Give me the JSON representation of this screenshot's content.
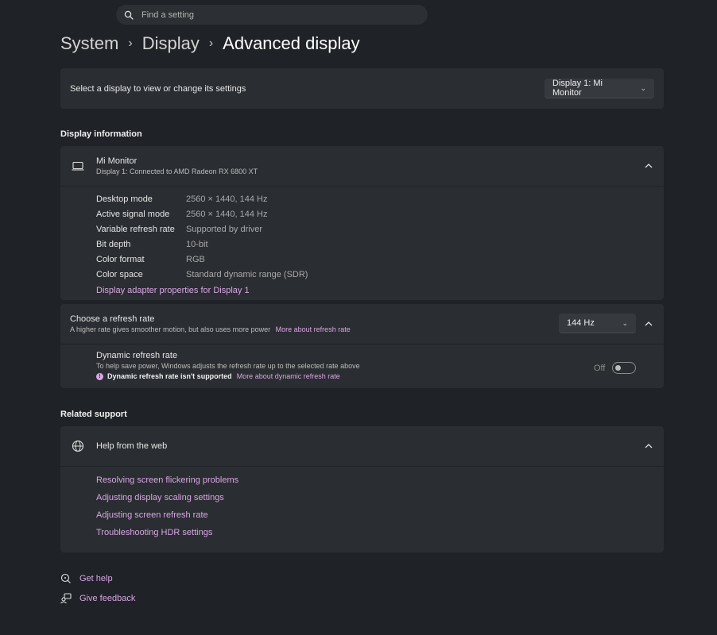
{
  "search": {
    "placeholder": "Find a setting"
  },
  "breadcrumb": {
    "level1": "System",
    "level2": "Display",
    "current": "Advanced display"
  },
  "select_display": {
    "label": "Select a display to view or change its settings",
    "value": "Display 1: Mi Monitor"
  },
  "display_info": {
    "section_title": "Display information",
    "monitor_name": "Mi Monitor",
    "monitor_sub": "Display 1: Connected to AMD Radeon RX 6800 XT",
    "rows": [
      {
        "label": "Desktop mode",
        "value": "2560 × 1440, 144 Hz"
      },
      {
        "label": "Active signal mode",
        "value": "2560 × 1440, 144 Hz"
      },
      {
        "label": "Variable refresh rate",
        "value": "Supported by driver"
      },
      {
        "label": "Bit depth",
        "value": "10-bit"
      },
      {
        "label": "Color format",
        "value": "RGB"
      },
      {
        "label": "Color space",
        "value": "Standard dynamic range (SDR)"
      }
    ],
    "adapter_link": "Display adapter properties for Display 1"
  },
  "refresh": {
    "title": "Choose a refresh rate",
    "subtitle": "A higher rate gives smoother motion, but also uses more power",
    "more_link": "More about refresh rate",
    "value": "144 Hz",
    "dynamic_title": "Dynamic refresh rate",
    "dynamic_sub": "To help save power, Windows adjusts the refresh rate up to the selected rate above",
    "not_supported": "Dynamic refresh rate isn't supported",
    "dynamic_link": "More about dynamic refresh rate",
    "toggle_state": "Off"
  },
  "related": {
    "section_title": "Related support",
    "help_title": "Help from the web",
    "links": [
      "Resolving screen flickering problems",
      "Adjusting display scaling settings",
      "Adjusting screen refresh rate",
      "Troubleshooting HDR settings"
    ]
  },
  "footer": {
    "get_help": "Get help",
    "give_feedback": "Give feedback"
  },
  "colors": {
    "accent": "#d8a6e4",
    "background": "#1f2227",
    "card": "#2a2d31"
  }
}
